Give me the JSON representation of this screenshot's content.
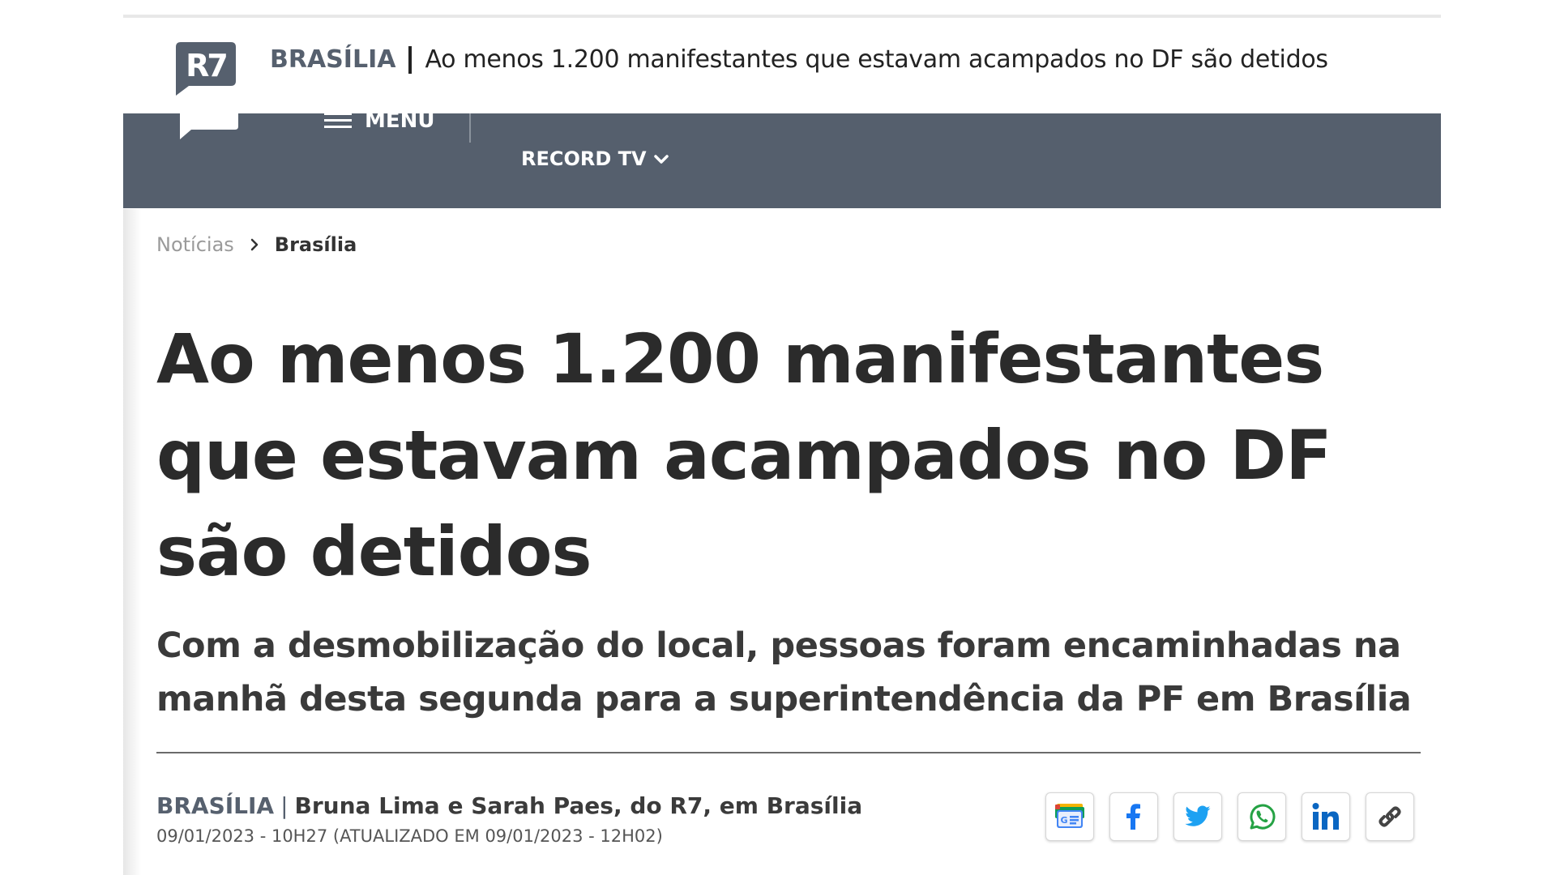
{
  "sticky_header": {
    "logo_text": "R7",
    "section": "BRASÍLIA",
    "headline": "Ao menos 1.200 manifestantes que estavam acampados no DF são detidos"
  },
  "nav": {
    "menu_label": "MENU",
    "record_tv_label": "RECORD TV"
  },
  "breadcrumb": {
    "items": [
      "Notícias",
      "Brasília"
    ]
  },
  "article": {
    "title": "Ao menos 1.200 manifestantes que estavam acampados no DF são detidos",
    "subtitle": "Com a desmobilização do local, pessoas foram encaminhadas na manhã desta segunda para a superintendência da PF em Brasília",
    "byline_section": "BRASÍLIA",
    "byline_separator": "|",
    "byline_authors": "Bruna Lima e Sarah Paes, do R7, em Brasília",
    "dateline": "09/01/2023 - 10H27 (ATUALIZADO EM 09/01/2023 - 12H02)"
  },
  "share": {
    "icons": [
      "google-news-icon",
      "facebook-icon",
      "twitter-icon",
      "whatsapp-icon",
      "linkedin-icon",
      "link-icon"
    ]
  },
  "colors": {
    "nav_bg": "#555f6d",
    "logo_bg": "#56606e",
    "section_text": "#56606e",
    "facebook": "#1877f2",
    "twitter": "#1da1f2",
    "whatsapp": "#25a244",
    "linkedin": "#0a66c2"
  }
}
